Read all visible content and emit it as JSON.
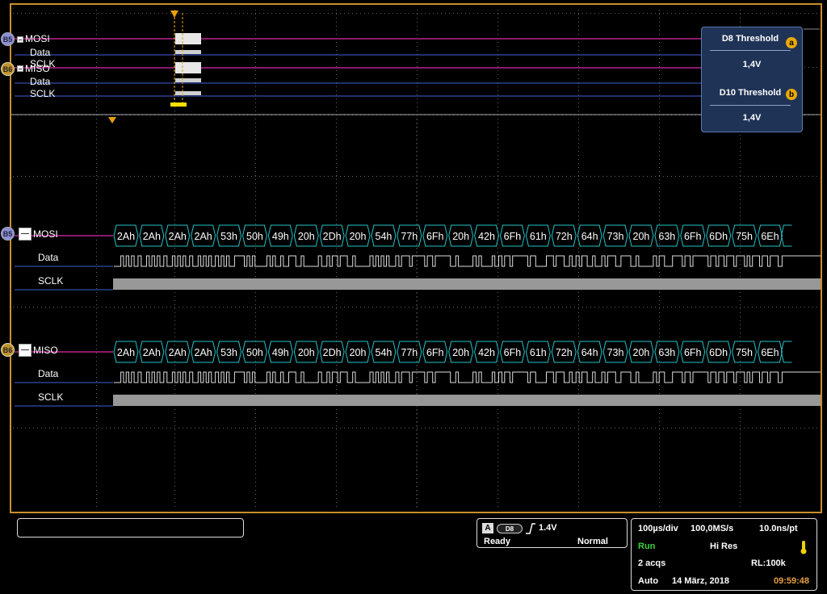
{
  "overview": {
    "groups": [
      {
        "badge": "B5",
        "bus": "MOSI",
        "data": "Data",
        "clock": "SCLK"
      },
      {
        "badge": "B6",
        "bus": "MISO",
        "data": "Data",
        "clock": "SCLK"
      }
    ]
  },
  "threshold_panel": {
    "items": [
      {
        "title": "D8 Threshold",
        "marker": "a",
        "value": "1,4V"
      },
      {
        "title": "D10 Threshold",
        "marker": "b",
        "value": "1,4V"
      }
    ]
  },
  "buses": [
    {
      "badge": "B5",
      "name": "MOSI",
      "data_label": "Data",
      "clock_label": "SCLK",
      "bytes": [
        "2Ah",
        "2Ah",
        "2Ah",
        "2Ah",
        "53h",
        "50h",
        "49h",
        "20h",
        "2Dh",
        "20h",
        "54h",
        "77h",
        "6Fh",
        "20h",
        "42h",
        "6Fh",
        "61h",
        "72h",
        "64h",
        "73h",
        "20h",
        "63h",
        "6Fh",
        "6Dh",
        "75h",
        "6Eh"
      ]
    },
    {
      "badge": "B6",
      "name": "MISO",
      "data_label": "Data",
      "clock_label": "SCLK",
      "bytes": [
        "2Ah",
        "2Ah",
        "2Ah",
        "2Ah",
        "53h",
        "50h",
        "49h",
        "20h",
        "2Dh",
        "20h",
        "54h",
        "77h",
        "6Fh",
        "20h",
        "42h",
        "6Fh",
        "61h",
        "72h",
        "64h",
        "73h",
        "20h",
        "63h",
        "6Fh",
        "6Dh",
        "75h",
        "6Eh"
      ]
    }
  ],
  "trigger": {
    "source_letter": "A",
    "channel": "D8",
    "level": "1.4V",
    "state": "Ready",
    "mode": "Normal"
  },
  "acquisition": {
    "time_div": "100µs/div",
    "sample_rate": "100,0MS/s",
    "resolution": "10.0ns/pt",
    "run_state": "Run",
    "acq_mode": "Hi Res",
    "acqs": "2 acqs",
    "record_length": "RL:100k",
    "auto": "Auto",
    "date": "14 März, 2018",
    "time": "09:59:48"
  },
  "colors": {
    "bus_line": "#8a1a6a",
    "data_line": "#3f5fd8",
    "decode": "#22c3c8",
    "frame": "#c98e2c",
    "marker": "#e8a000"
  }
}
